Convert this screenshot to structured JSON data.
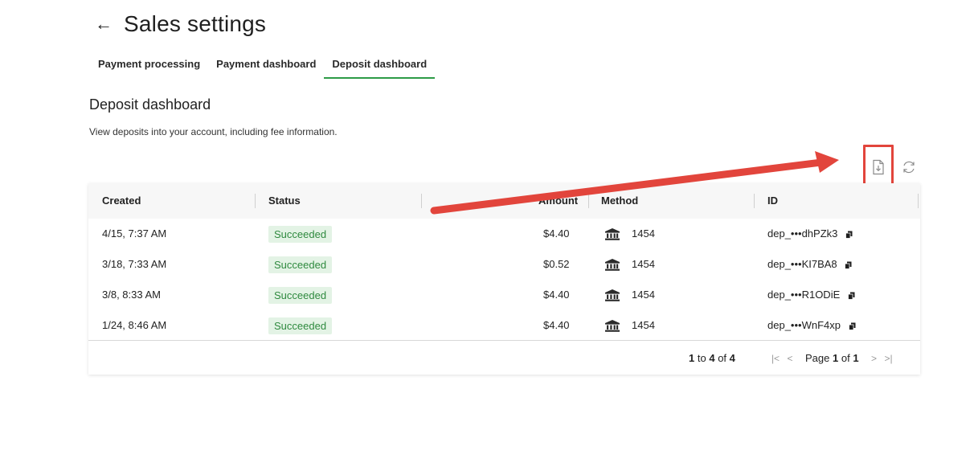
{
  "header": {
    "title": "Sales settings",
    "back_icon": "arrow-left-icon"
  },
  "tabs": [
    {
      "label": "Payment processing",
      "active": false
    },
    {
      "label": "Payment dashboard",
      "active": false
    },
    {
      "label": "Deposit dashboard",
      "active": true
    }
  ],
  "section": {
    "title": "Deposit dashboard",
    "description": "View deposits into your account, including fee information."
  },
  "toolbar": {
    "export_icon": "download-file-icon",
    "refresh_icon": "refresh-icon"
  },
  "table": {
    "columns": [
      "Created",
      "Status",
      "Amount",
      "Method",
      "ID"
    ],
    "rows": [
      {
        "created": "4/15, 7:37 AM",
        "status": "Succeeded",
        "amount": "$4.40",
        "method": "1454",
        "id": "dep_•••dhPZk3"
      },
      {
        "created": "3/18, 7:33 AM",
        "status": "Succeeded",
        "amount": "$0.52",
        "method": "1454",
        "id": "dep_•••KI7BA8"
      },
      {
        "created": "3/8, 8:33 AM",
        "status": "Succeeded",
        "amount": "$4.40",
        "method": "1454",
        "id": "dep_•••R1ODiE"
      },
      {
        "created": "1/24, 8:46 AM",
        "status": "Succeeded",
        "amount": "$4.40",
        "method": "1454",
        "id": "dep_•••WnF4xp"
      }
    ]
  },
  "footer": {
    "range_start": "1",
    "range_to": "to",
    "range_end": "4",
    "range_of": "of",
    "total": "4",
    "page_label": "Page",
    "page_current": "1",
    "page_of": "of",
    "page_total": "1"
  },
  "colors": {
    "accent": "#2e9b47",
    "badge_bg": "#e3f3e5",
    "badge_text": "#2f8a3f",
    "annotation": "#e2453c"
  }
}
